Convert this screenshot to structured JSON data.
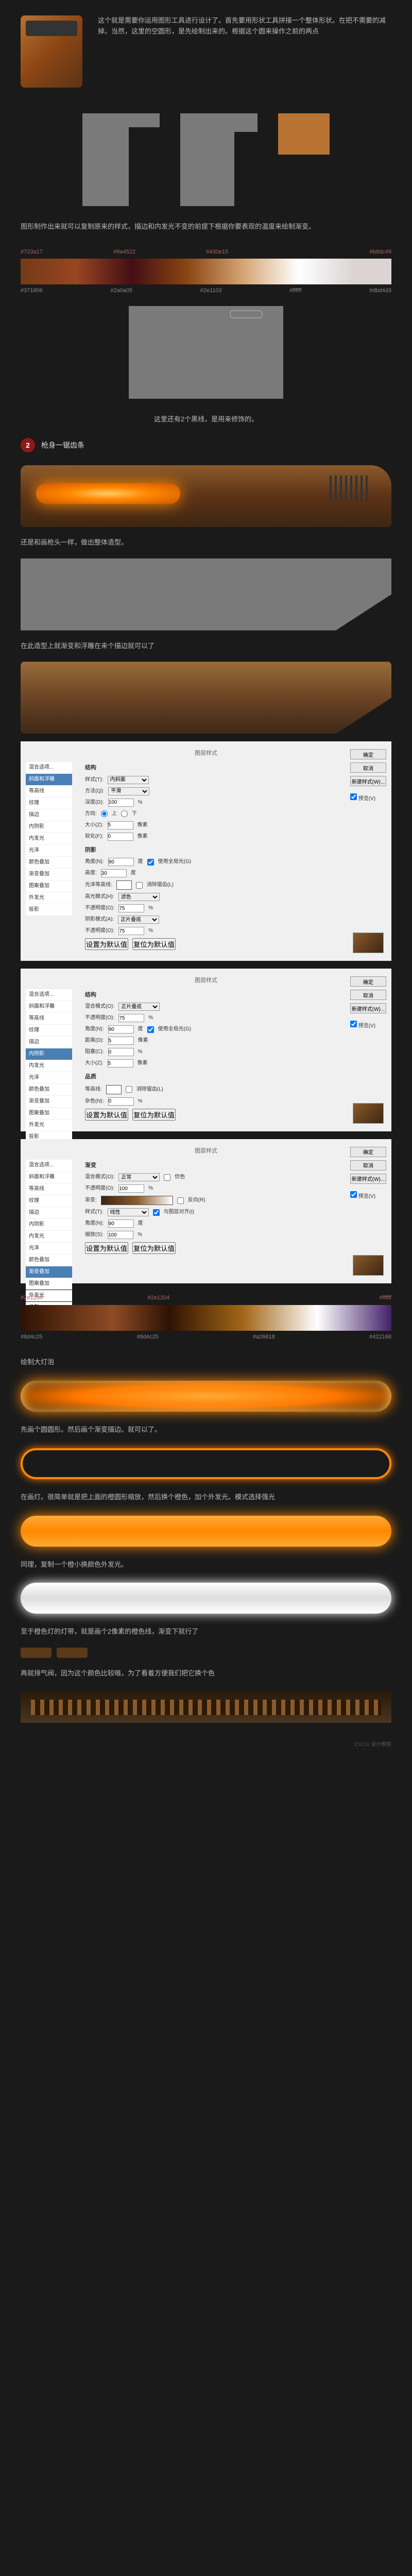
{
  "intro_text": "这个就是需要你运用图形工具进行设计了。首先要用形状工具拼接一个整体形状。在把不需要的减掉。当然，这里的空圆形，是先绘制出来的。根据这个圆来操作之前的两点",
  "text_copy_style": "图形制作出来就可以复制原来的样式，描边和内发光不变的前提下根据你要表现的温度来绘制渐变。",
  "color_strip": {
    "top_labels": [
      "#723a17",
      "#9a4522",
      "#430e15",
      "",
      "#b8dc49"
    ],
    "bottom_labels": [
      "#371806",
      "#2a0a05",
      "#2e1103",
      "#ffffff",
      "#dbd4d3"
    ]
  },
  "text_decoration": "这里还有2个黑线，是用来修饰的。",
  "step2": {
    "num": "2",
    "title": "枪身一锯齿条"
  },
  "text_same_as_head": "还是和画枪头一样，做出整体造型。",
  "text_emboss": "在此造型上就渐变和浮雕在来个描边就可以了",
  "dialog": {
    "title": "图层样式",
    "sidebar": [
      "混合选项...",
      "斜面和浮雕",
      "等高线",
      "纹理",
      "描边",
      "内阴影",
      "内发光",
      "光泽",
      "颜色叠加",
      "渐变叠加",
      "图案叠加",
      "外发光",
      "投影"
    ],
    "structure_label": "结构",
    "style_label": "样式(T):",
    "style_val": "内斜面",
    "method_label": "方法(Q):",
    "method_val": "平滑",
    "depth_label": "深度(D):",
    "depth_val": "100",
    "direction_label": "方向:",
    "dir_up": "上",
    "dir_down": "下",
    "size_label": "大小(Z):",
    "size_val": "5",
    "soften_label": "软化(F):",
    "soften_val": "0",
    "shade_label": "阴影",
    "angle_label": "角度(N):",
    "angle_val": "90",
    "global_label": "使用全局光(G)",
    "altitude_label": "高度:",
    "altitude_val": "30",
    "gloss_label": "光泽等高线:",
    "anti_alias": "消除锯齿(L)",
    "highlight_label": "高光模式(H):",
    "highlight_val": "滤色",
    "opacity_label": "不透明度(O):",
    "opacity_val": "75",
    "shadow_mode_label": "阴影模式(A):",
    "shadow_mode_val": "正片叠底",
    "default_btn": "设置为默认值",
    "reset_btn": "复位为默认值",
    "btn_ok": "确定",
    "btn_cancel": "取消",
    "btn_new": "新建样式(W)...",
    "preview_label": "预览(V)"
  },
  "dialog2_active": "内阴影",
  "dialog3_active": "渐变叠加",
  "dialog3": {
    "blend_label": "混合模式(O):",
    "blend_val": "正常",
    "dither_label": "仿色",
    "gradient_label": "渐变:",
    "reverse_label": "反向(R)",
    "style_val2": "线性",
    "align_label": "与图层对齐(I)",
    "angle_val2": "90",
    "scale_label": "缩放(S):",
    "scale_val": "100"
  },
  "color_strip2": {
    "top_labels": [
      "#2e1204",
      "#2e1204",
      "",
      "#ffffff"
    ],
    "bottom_labels": [
      "#8d4c25",
      "#8d4c25",
      "#a26618",
      "#422168"
    ]
  },
  "text_big_light": "绘制大灯泡",
  "text_rounded": "先画个圆圆形。然后画个渐变描边。就可以了。",
  "text_light_layer": "在画灯。很简单就是把上面的橙圆形缩放，然后换个橙色，加个外发光。模式选择强光",
  "text_white_light": "同理，复制一个橙小换颜色外发光。",
  "text_orange_light": "至于橙色灯的灯带，就是画个2像素的橙色线，渐变下就行了",
  "text_vent": "再就排气阀，因为这个颜色比较暗，为了看着方便我们把它换个色",
  "footer": "CXCG 设计教程"
}
